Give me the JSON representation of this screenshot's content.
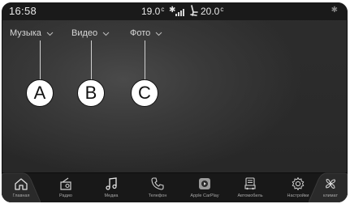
{
  "status_bar": {
    "time": "16:58",
    "temp_left": "19.0",
    "temp_left_unit": "c",
    "temp_right": "20.0",
    "temp_right_unit": "c"
  },
  "tabs": [
    {
      "label": "Музыка"
    },
    {
      "label": "Видео"
    },
    {
      "label": "Фото"
    }
  ],
  "callouts": [
    "A",
    "B",
    "C"
  ],
  "dock": {
    "items": [
      {
        "label": "Главная",
        "icon": "home-icon"
      },
      {
        "label": "Радио",
        "icon": "radio-icon"
      },
      {
        "label": "Медиа",
        "icon": "music-note-icon"
      },
      {
        "label": "Телефон",
        "icon": "phone-icon"
      },
      {
        "label": "Apple CarPlay",
        "icon": "carplay-icon"
      },
      {
        "label": "Автомобиль",
        "icon": "car-icon"
      },
      {
        "label": "Настройки",
        "icon": "gear-icon"
      },
      {
        "label": "климат",
        "icon": "fan-icon"
      }
    ]
  },
  "colors": {
    "background": "#2d2d2d",
    "status_bar": "#1a1a1a",
    "dock": "#181818",
    "text": "#d6d6d6"
  }
}
